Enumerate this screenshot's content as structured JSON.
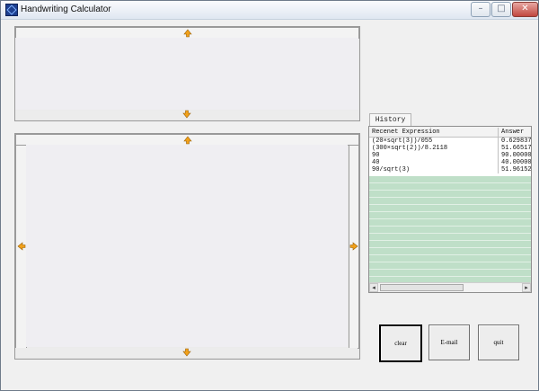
{
  "window": {
    "title": "Handwriting Calculator",
    "controls": {
      "minimize": "–",
      "maximize": "□",
      "close": "✕"
    }
  },
  "history": {
    "tab_label": "History",
    "columns": [
      "Recenet Expression",
      "Answer"
    ],
    "rows": [
      {
        "expression": "(20×sqrt(3))/055",
        "answer": "0.629837"
      },
      {
        "expression": "(300×sqrt(2))/8.2118",
        "answer": "51.665173"
      },
      {
        "expression": "90",
        "answer": "90.000000"
      },
      {
        "expression": "40",
        "answer": "40.000000"
      },
      {
        "expression": "90/sqrt(3)",
        "answer": "51.961524"
      }
    ]
  },
  "buttons": {
    "clear": "clear",
    "email": "E-mail",
    "quit": "quit"
  },
  "colors": {
    "arrow": "#f2a11a",
    "history_fill": "#bfdfc8"
  }
}
